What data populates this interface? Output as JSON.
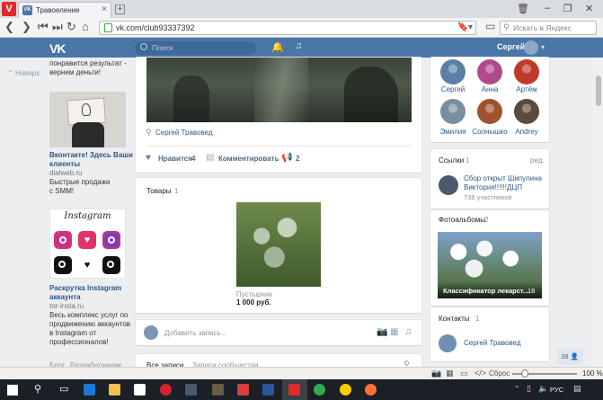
{
  "browser": {
    "tab_title": "Травоеление",
    "url": "vk.com/club93337392",
    "search_placeholder": "Искать в Яндекс",
    "zoom_reset": "Сброс",
    "zoom": "100 %"
  },
  "vk": {
    "search_placeholder": "Поиск",
    "user_name": "Сергей",
    "back_label": "Наверх"
  },
  "left_ads": {
    "top_text_1": "понравится результат -",
    "top_text_2": "вернем деньги!",
    "ad1": {
      "title_1": "Вконтакте! Здесь Ваши",
      "title_2": "клиенты",
      "domain": "dialweb.ru",
      "text_1": "Быстрые продажи",
      "text_2": "с SMM!"
    },
    "ad2": {
      "img_label": "Instagram",
      "title_1": "Раскрутка Instagram",
      "title_2": "аккаунта",
      "domain": "tor-insta.ru",
      "text_1": "Весь комплекс услуг по",
      "text_2": "продвижению аккаунтов",
      "text_3": "в Instagram от",
      "text_4": "профессионалов!"
    },
    "footer_1": "Блог",
    "footer_2": "Разработчикам"
  },
  "post": {
    "author": "Сергей Травовед",
    "like_label": "Нравится",
    "like_count": "4",
    "comment_label": "Комментировать",
    "share_count": "2"
  },
  "goods": {
    "title": "Товары",
    "count": "1",
    "item_name": "Пустырник",
    "item_price": "1 000 руб."
  },
  "composer": {
    "placeholder": "Добавить запись..."
  },
  "wall_tabs": {
    "all": "Все записи",
    "community": "Записи сообщества"
  },
  "members": [
    {
      "name": "Сергей",
      "color": "#5b7fa6"
    },
    {
      "name": "Анна",
      "color": "#b04a8c"
    },
    {
      "name": "Артём",
      "color": "#c0392b"
    },
    {
      "name": "Эмилия",
      "color": "#7a8f9e"
    },
    {
      "name": "Солнышко",
      "color": "#a0522d"
    },
    {
      "name": "Andrey",
      "color": "#5d4a3a"
    }
  ],
  "links": {
    "title": "Ссылки",
    "count": "1",
    "edit": "ред.",
    "item_title_1": "Сбор открыт Шипулина",
    "item_title_2": "Виктория!!!!!!ДЦП",
    "item_sub": "738 участников"
  },
  "albums": {
    "title": "Фотоальбомы",
    "count": "2",
    "album_name": "Классификатор лекарст...",
    "album_count": "18"
  },
  "contacts": {
    "title": "Контакты",
    "count": "1",
    "name": "Сергей Травовед"
  },
  "chat_badge": "38",
  "tray": {
    "lang": "РУС"
  }
}
